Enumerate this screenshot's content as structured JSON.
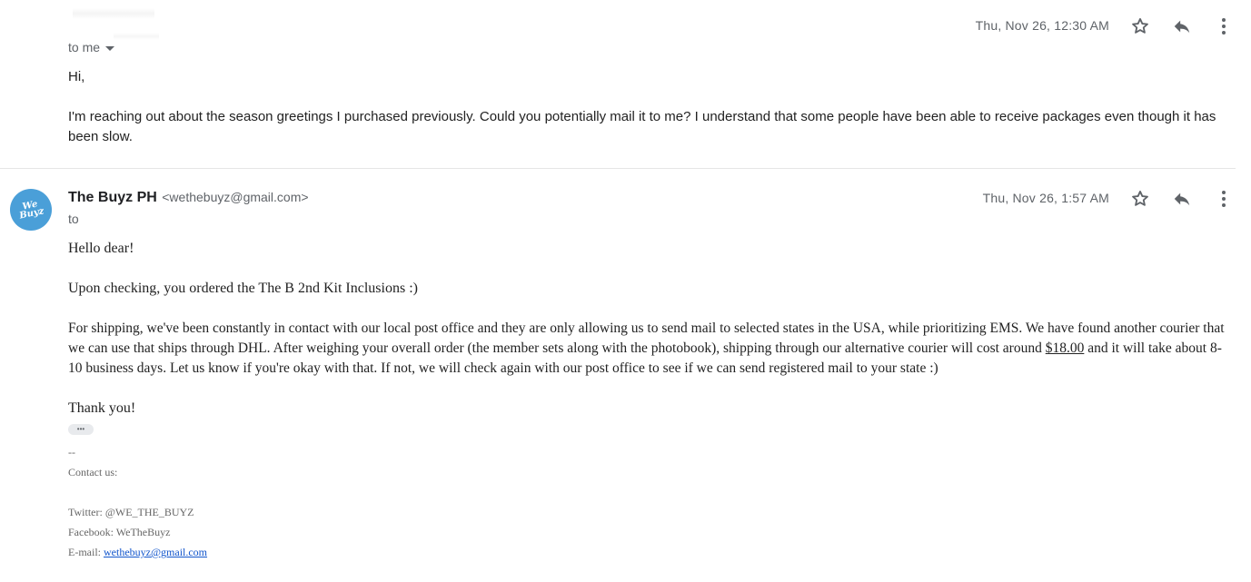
{
  "message1": {
    "recipient_label": "to me",
    "date": "Thu, Nov 26, 12:30 AM",
    "greeting": "Hi,",
    "body": "I'm reaching out about the season greetings I purchased previously. Could you potentially mail it to me? I understand that some people have been able to receive packages even though it has been slow."
  },
  "message2": {
    "avatar_text": "We Buyz",
    "sender_name": "The Buyz PH",
    "sender_email": "<wethebuyz@gmail.com>",
    "recipient_label": "to",
    "date": "Thu, Nov 26, 1:57 AM",
    "greeting": "Hello dear!",
    "para1": "Upon checking, you ordered the The B 2nd Kit Inclusions :)",
    "para2_before": "For shipping, we've been constantly in contact with our local post office and they are only allowing us to send mail to selected states in the USA, while prioritizing EMS. We have found another courier that we can use that ships through DHL. After weighing your overall order (the member sets along with the photobook), shipping through our alternative courier will cost around ",
    "para2_amount": "$18.00",
    "para2_after": " and it will take about 8-10 business days. Let us know if you're okay with that. If not, we will check again with our post office to see if we can send registered mail to your state :)",
    "closing": "Thank you!",
    "ellipsis": "•••",
    "signature": {
      "separator": "--",
      "contact_label": "Contact us:",
      "twitter": "Twitter: @WE_THE_BUYZ",
      "facebook": "Facebook: WeTheBuyz",
      "email_label": "E-mail: ",
      "email_link": "wethebuyz@gmail.com"
    }
  },
  "colors": {
    "icon": "#5f6368",
    "avatar_bg": "#4a9fd8",
    "link": "#1155cc",
    "divider": "#e5e5e5"
  },
  "icons": [
    "star-icon",
    "reply-icon",
    "more-vert-icon",
    "dropdown-arrow-icon"
  ]
}
